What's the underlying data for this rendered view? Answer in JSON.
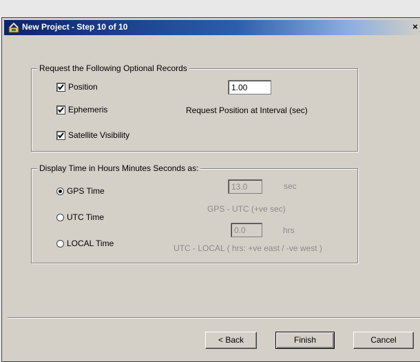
{
  "window": {
    "title": "New Project - Step 10 of 10",
    "close_glyph": "×"
  },
  "optional_records": {
    "group_label": "Request the Following Optional Records",
    "position_label": "Position",
    "position_checked": true,
    "ephemeris_label": "Ephemeris",
    "ephemeris_checked": true,
    "satellite_visibility_label": "Satellite Visibility",
    "satellite_visibility_checked": true,
    "interval_value": "1.00",
    "interval_label": "Request Position at Interval (sec)"
  },
  "time_display": {
    "group_label": "Display Time in Hours Minutes Seconds as:",
    "options": [
      {
        "label": "GPS Time",
        "selected": true
      },
      {
        "label": "UTC Time",
        "selected": false
      },
      {
        "label": "LOCAL Time",
        "selected": false
      }
    ],
    "gps_offset_value": "13.0",
    "gps_offset_unit": "sec",
    "gps_offset_label": "GPS - UTC (+ve sec)",
    "local_offset_value": "0.0",
    "local_offset_unit": "hrs",
    "local_offset_label": "UTC - LOCAL ( hrs: +ve east / -ve west )"
  },
  "buttons": {
    "back": "< Back",
    "finish": "Finish",
    "cancel": "Cancel"
  },
  "icons": {
    "title": "wizard-app-icon",
    "checkmark": "checkmark-icon"
  }
}
